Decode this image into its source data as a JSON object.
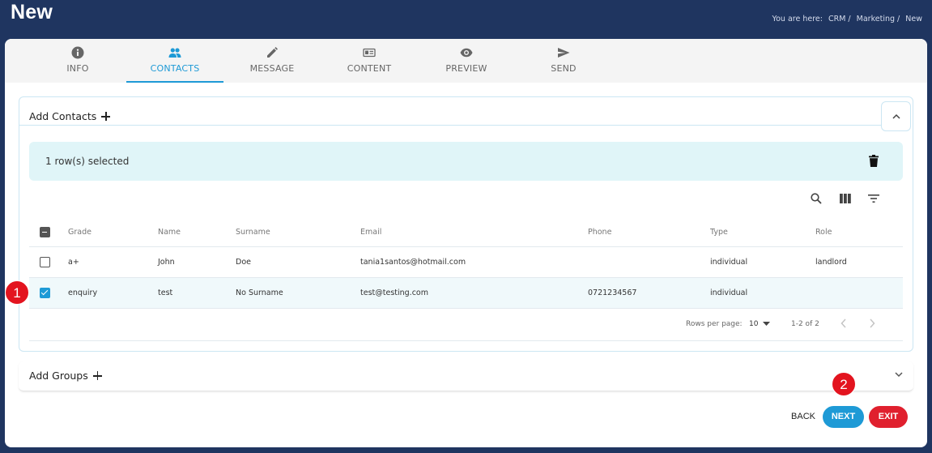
{
  "page": {
    "title": "New"
  },
  "breadcrumb": {
    "prefix": "You are here:",
    "items": [
      "CRM /",
      "Marketing /",
      "New"
    ]
  },
  "tabs": [
    {
      "label": "INFO",
      "icon": "info-icon"
    },
    {
      "label": "CONTACTS",
      "icon": "people-icon",
      "active": true
    },
    {
      "label": "MESSAGE",
      "icon": "pencil-icon"
    },
    {
      "label": "CONTENT",
      "icon": "content-icon"
    },
    {
      "label": "PREVIEW",
      "icon": "eye-icon"
    },
    {
      "label": "SEND",
      "icon": "send-icon"
    }
  ],
  "contacts_panel": {
    "title": "Add Contacts",
    "selection_text": "1 row(s) selected",
    "columns": [
      "Grade",
      "Name",
      "Surname",
      "Email",
      "Phone",
      "Type",
      "Role"
    ],
    "rows": [
      {
        "grade": "a+",
        "name": "John",
        "surname": "Doe",
        "email": "tania1santos@hotmail.com",
        "phone": "",
        "type": "individual",
        "role": "landlord",
        "checked": false
      },
      {
        "grade": "enquiry",
        "name": "test",
        "surname": "No Surname",
        "email": "test@testing.com",
        "phone": "0721234567",
        "type": "individual",
        "role": "",
        "checked": true
      }
    ],
    "pagination": {
      "rows_per_page_label": "Rows per page:",
      "rows_per_page": "10",
      "range": "1-2 of 2"
    }
  },
  "groups_panel": {
    "title": "Add Groups"
  },
  "actions": {
    "back": "BACK",
    "next": "NEXT",
    "exit": "EXIT"
  },
  "markers": [
    "1",
    "2"
  ],
  "colors": {
    "header_bg": "#1f3560",
    "accent": "#1e9ad6",
    "danger": "#e0202e",
    "selection_bg": "#e0f5f8"
  }
}
